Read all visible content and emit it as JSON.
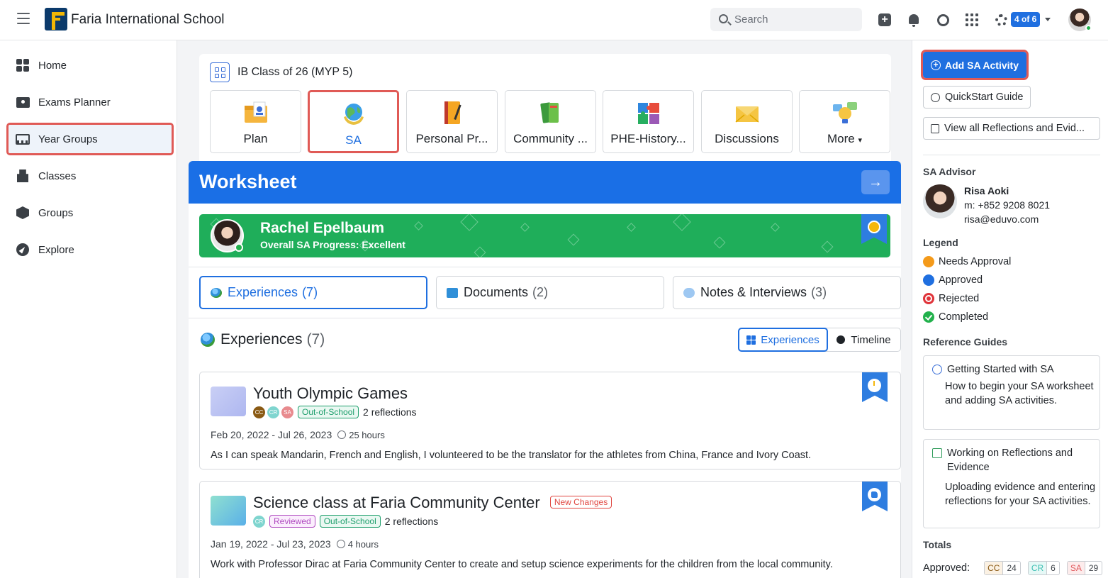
{
  "topbar": {
    "school_name": "Faria International School",
    "search_placeholder": "Search",
    "progress_badge": "4 of 6"
  },
  "sidebar": {
    "items": [
      {
        "label": "Home",
        "icon": "home-icon"
      },
      {
        "label": "Exams Planner",
        "icon": "exams-planner-icon"
      },
      {
        "label": "Year Groups",
        "icon": "year-groups-icon",
        "active": true
      },
      {
        "label": "Classes",
        "icon": "classes-icon"
      },
      {
        "label": "Groups",
        "icon": "groups-icon"
      },
      {
        "label": "Explore",
        "icon": "explore-icon"
      }
    ]
  },
  "class": {
    "title": "IB Class of 26 (MYP 5)",
    "tiles": [
      {
        "label": "Plan"
      },
      {
        "label": "SA",
        "active": true
      },
      {
        "label": "Personal Pr..."
      },
      {
        "label": "Community ..."
      },
      {
        "label": "PHE-History..."
      },
      {
        "label": "Discussions"
      },
      {
        "label": "More"
      }
    ]
  },
  "worksheet": {
    "title": "Worksheet",
    "student": {
      "name": "Rachel Epelbaum",
      "progress": "Overall SA Progress: Excellent"
    },
    "tabs": [
      {
        "label": "Experiences",
        "count": "(7)"
      },
      {
        "label": "Documents",
        "count": "(2)"
      },
      {
        "label": "Notes & Interviews",
        "count": "(3)"
      }
    ],
    "section": {
      "title": "Experiences",
      "count": "(7)"
    },
    "view_toggle": {
      "experiences": "Experiences",
      "timeline": "Timeline"
    },
    "experiences": [
      {
        "title": "Youth Olympic Games",
        "badge": "",
        "tags": [
          "CC",
          "CR",
          "SA"
        ],
        "pills": [
          "Out-of-School"
        ],
        "reflections": "2 reflections",
        "dates": "Feb 20, 2022 - Jul 26, 2023",
        "hours": "25 hours",
        "description": "As I can speak Mandarin, French and English, I volunteered to be the translator for the athletes from China, France and Ivory Coast.",
        "status_icon": "clock-icon"
      },
      {
        "title": "Science class at Faria Community Center",
        "badge": "New Changes",
        "tags": [
          "CR"
        ],
        "pills": [
          "Reviewed",
          "Out-of-School"
        ],
        "reflections": "2 reflections",
        "dates": "Jan 19, 2022 - Jul 23, 2023",
        "hours": "4 hours",
        "description": "Work with Professor Dirac at Faria Community Center to create and setup science experiments for the children from the local community.",
        "status_icon": "thumbs-up-icon"
      }
    ]
  },
  "right_panel": {
    "add_button": "Add SA Activity",
    "quickstart": "QuickStart Guide",
    "view_all": "View all Reflections and Evid...",
    "advisor_heading": "SA Advisor",
    "advisor": {
      "name": "Risa Aoki",
      "phone": "m: +852 9208 8021",
      "email": "risa@eduvo.com"
    },
    "legend_heading": "Legend",
    "legend": [
      {
        "label": "Needs Approval",
        "color": "#f49a1a"
      },
      {
        "label": "Approved",
        "color": "#1f6fe0"
      },
      {
        "label": "Rejected",
        "color": "#e0343a"
      },
      {
        "label": "Completed",
        "color": "#22b14c"
      }
    ],
    "guides_heading": "Reference Guides",
    "guides": [
      {
        "title": "Getting Started with SA",
        "description": "How to begin your SA worksheet and adding SA activities."
      },
      {
        "title": "Working on Reflections and Evidence",
        "description": "Uploading evidence and entering reflections for your SA activities."
      }
    ],
    "totals_heading": "Totals",
    "totals": {
      "label": "Approved:",
      "items": [
        {
          "key": "CC",
          "value": "24"
        },
        {
          "key": "CR",
          "value": "6"
        },
        {
          "key": "SA",
          "value": "29"
        }
      ]
    }
  }
}
